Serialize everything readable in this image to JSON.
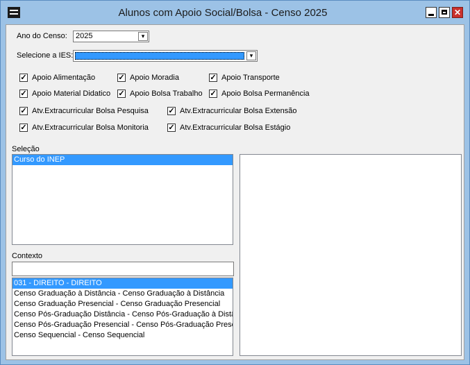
{
  "window": {
    "title": "Alunos com Apoio Social/Bolsa - Censo 2025",
    "close_glyph": "✕"
  },
  "form": {
    "ano_label": "Ano do Censo:",
    "ano_value": "2025",
    "ies_label": "Selecione a IES:",
    "ies_value": ""
  },
  "checkboxes": [
    {
      "label": "Apoio Alimentação",
      "checked": true
    },
    {
      "label": "Apoio Moradia",
      "checked": true
    },
    {
      "label": "Apoio Transporte",
      "checked": true
    },
    {
      "label": "Apoio Material Didatico",
      "checked": true
    },
    {
      "label": "Apoio Bolsa Trabalho",
      "checked": true
    },
    {
      "label": "Apoio Bolsa Permanência",
      "checked": true
    },
    {
      "label": "Atv.Extracurricular Bolsa Pesquisa",
      "checked": true
    },
    {
      "label": "Atv.Extracurricular Bolsa Extensão",
      "checked": true
    },
    {
      "label": "Atv.Extracurricular Bolsa Monitoria",
      "checked": true
    },
    {
      "label": "Atv.Extracurricular Bolsa Estágio",
      "checked": true
    }
  ],
  "selecao": {
    "label": "Seleção",
    "items": [
      "Curso do INEP"
    ]
  },
  "contexto": {
    "label": "Contexto",
    "filter_value": "",
    "items": [
      "031 - DIREITO - DIREITO",
      "Censo Graduação à Distância - Censo Graduação à Distância",
      "Censo Graduação Presencial - Censo Graduação Presencial",
      "Censo Pós-Graduação Distância - Censo Pós-Graduação à Distância",
      "Censo Pós-Graduação Presencial - Censo Pós-Graduação Presencial",
      "Censo Sequencial - Censo Sequencial"
    ]
  },
  "icons": {
    "dropdown": "▾",
    "check": "✓"
  }
}
